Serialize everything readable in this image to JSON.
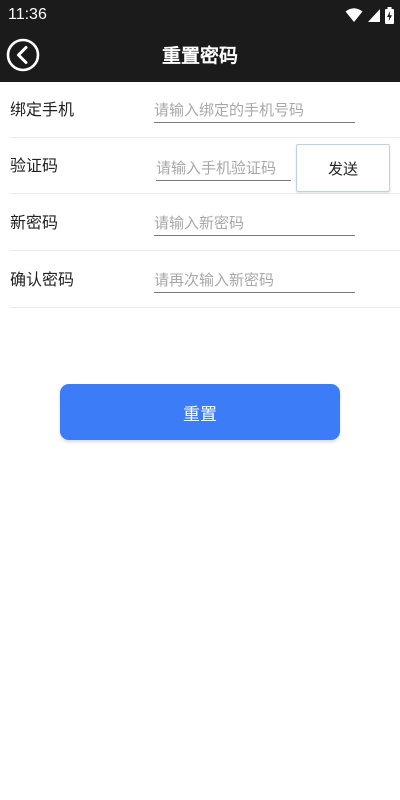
{
  "status_bar": {
    "time": "11:36",
    "icons": [
      "wifi-icon",
      "signal-icon",
      "battery-charging-icon"
    ]
  },
  "header": {
    "title": "重置密码",
    "back_icon": "back-arrow-icon"
  },
  "colors": {
    "header_bg": "#1b1b1b",
    "accent": "#3c7cf6",
    "placeholder": "#a8a8a8"
  },
  "form": {
    "phone": {
      "label": "绑定手机",
      "value": "",
      "placeholder": "请输入绑定的手机号码"
    },
    "code": {
      "label": "验证码",
      "value": "",
      "placeholder": "请输入手机验证码",
      "send_label": "发送"
    },
    "new_password": {
      "label": "新密码",
      "value": "",
      "placeholder": "请输入新密码"
    },
    "confirm_password": {
      "label": "确认密码",
      "value": "",
      "placeholder": "请再次输入新密码"
    }
  },
  "actions": {
    "reset_label": "重置"
  }
}
